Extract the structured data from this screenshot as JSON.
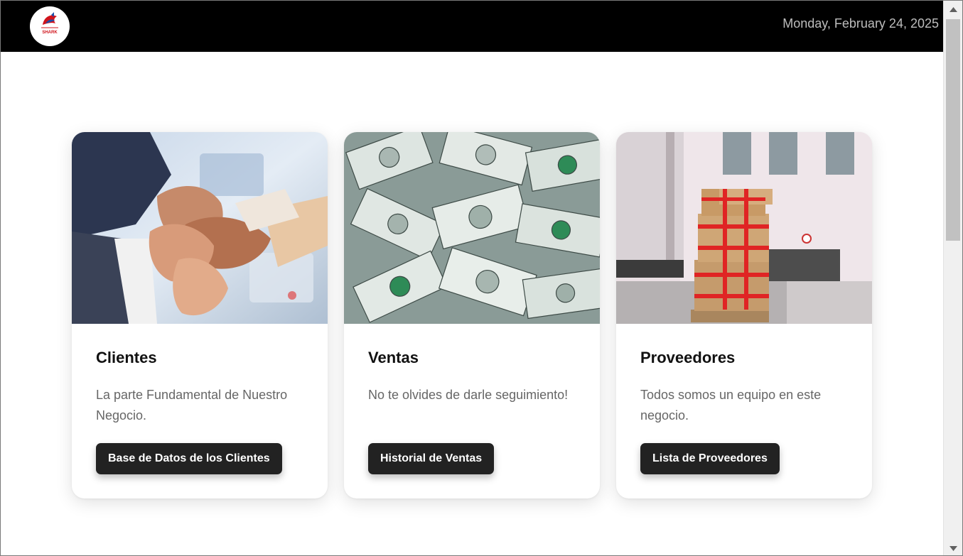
{
  "header": {
    "logo_alt": "SHARK",
    "date": "Monday, February 24, 2025"
  },
  "cards": [
    {
      "title": "Clientes",
      "description": "La parte Fundamental de Nuestro Negocio.",
      "button": "Base de Datos de los Clientes",
      "image": "teamwork-hands-photo"
    },
    {
      "title": "Ventas",
      "description": "No te olvides de darle seguimiento!",
      "button": "Historial de Ventas",
      "image": "dollar-bills-photo"
    },
    {
      "title": "Proveedores",
      "description": "Todos somos un equipo en este negocio.",
      "button": "Lista de Proveedores",
      "image": "delivery-boxes-photo"
    }
  ],
  "colors": {
    "header_bg": "#000000",
    "button_bg": "#222222",
    "date_text": "#bdbdbd"
  }
}
